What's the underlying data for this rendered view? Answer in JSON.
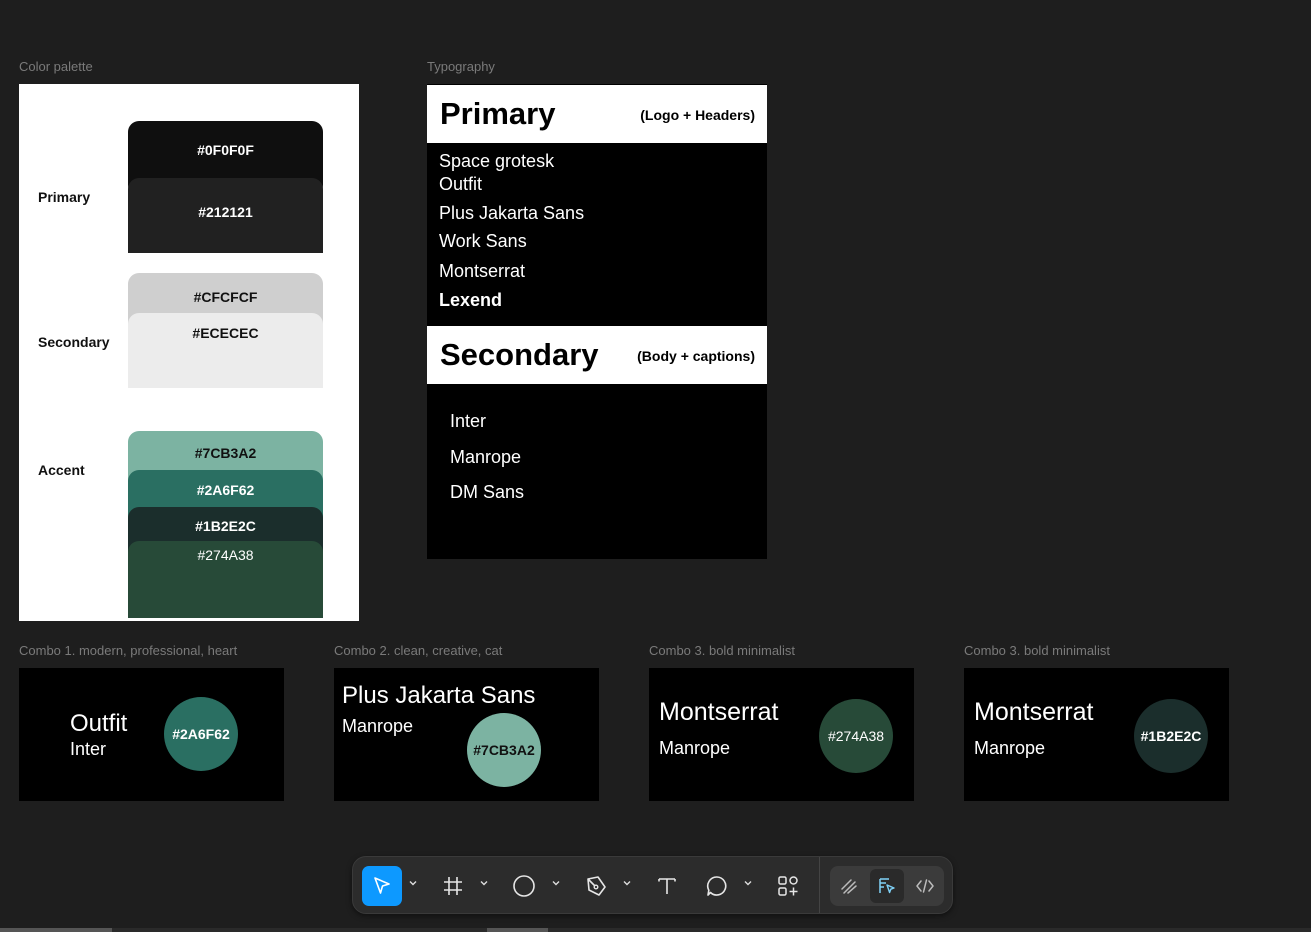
{
  "frames": {
    "palette_label": "Color palette",
    "typography_label": "Typography"
  },
  "palette": {
    "primary_label": "Primary",
    "secondary_label": "Secondary",
    "accent_label": "Accent",
    "primary": [
      "#0F0F0F",
      "#212121"
    ],
    "primary_text": [
      "#0F0F0F",
      "#212121"
    ],
    "secondary": [
      "#CFCFCF",
      "#ECECEC"
    ],
    "accent": [
      "#7CB3A2",
      "#2A6F62",
      "#1B2E2C",
      "#274A38"
    ]
  },
  "typography": {
    "primary_title": "Primary",
    "primary_note": "(Logo + Headers)",
    "primary_fonts": [
      "Space grotesk",
      "Outfit",
      "Plus Jakarta Sans",
      "Work Sans",
      "Montserrat",
      "Lexend"
    ],
    "secondary_title": "Secondary",
    "secondary_note": "(Body + captions)",
    "secondary_fonts": [
      "Inter",
      "Manrope",
      "DM Sans"
    ]
  },
  "combos": [
    {
      "label": "Combo 1. modern, professional, heart",
      "heading": "Outfit",
      "body": "Inter",
      "color": "#2A6F62"
    },
    {
      "label": "Combo 2. clean, creative, cat",
      "heading": "Plus Jakarta Sans",
      "body": "Manrope",
      "color": "#7CB3A2"
    },
    {
      "label": "Combo 3. bold minimalist",
      "heading": "Montserrat",
      "body": "Manrope",
      "color": "#274A38"
    },
    {
      "label": "Combo 3. bold minimalist",
      "heading": "Montserrat",
      "body": "Manrope",
      "color": "#1B2E2C"
    }
  ],
  "colors": {
    "canvas": "#1e1e1e",
    "accent_blue": "#0d99ff",
    "toolbar": "#2c2c2c"
  },
  "toolbar_icons": [
    "move-icon",
    "frame-icon",
    "ellipse-icon",
    "pen-icon",
    "text-icon",
    "comment-icon",
    "actions-icon",
    "draw-mode-icon",
    "design-mode-icon",
    "dev-mode-icon"
  ]
}
